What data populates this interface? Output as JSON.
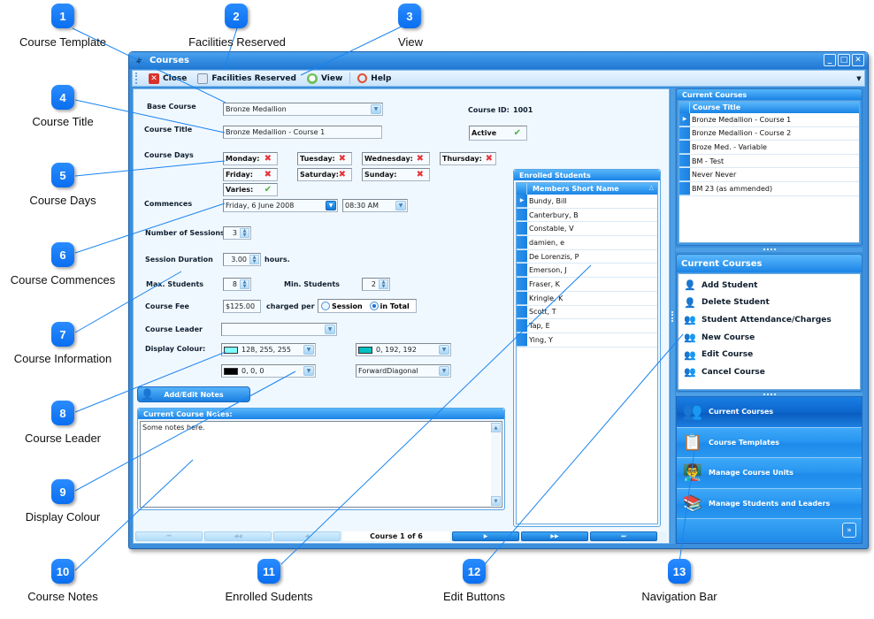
{
  "callouts": [
    {
      "n": "1",
      "label": "Course Template"
    },
    {
      "n": "2",
      "label": "Facilities Reserved"
    },
    {
      "n": "3",
      "label": "View"
    },
    {
      "n": "4",
      "label": "Course Title"
    },
    {
      "n": "5",
      "label": "Course Days"
    },
    {
      "n": "6",
      "label": "Course Commences"
    },
    {
      "n": "7",
      "label": "Course Information"
    },
    {
      "n": "8",
      "label": "Course Leader"
    },
    {
      "n": "9",
      "label": "Display Colour"
    },
    {
      "n": "10",
      "label": "Course Notes"
    },
    {
      "n": "11",
      "label": "Enrolled Sudents"
    },
    {
      "n": "12",
      "label": "Edit Buttons"
    },
    {
      "n": "13",
      "label": "Navigation Bar"
    }
  ],
  "window": {
    "title": "Courses",
    "controls": {
      "minimize": "_",
      "maximize": "□",
      "close": "✕"
    }
  },
  "toolbar": {
    "close": "Close",
    "facilities": "Facilities Reserved",
    "view": "View",
    "help": "Help"
  },
  "form": {
    "base_course_label": "Base Course",
    "base_course_value": "Bronze Medallion",
    "course_title_label": "Course Title",
    "course_title_value": "Bronze Medallion - Course 1",
    "course_id_label": "Course ID:",
    "course_id_value": "1001",
    "active_label": "Active",
    "active_checked": true,
    "course_days_label": "Course Days",
    "days": [
      {
        "label": "Monday:",
        "on": false
      },
      {
        "label": "Tuesday:",
        "on": false
      },
      {
        "label": "Wednesday:",
        "on": false
      },
      {
        "label": "Thursday:",
        "on": false
      },
      {
        "label": "Friday:",
        "on": false
      },
      {
        "label": "Saturday:",
        "on": false
      },
      {
        "label": "Sunday:",
        "on": false
      },
      {
        "label": "Varies:",
        "on": true
      }
    ],
    "commences_label": "Commences",
    "commences_date": "Friday, 6 June 2008",
    "commences_time": "08:30 AM",
    "sessions_label": "Number of Sessions",
    "sessions_value": "3",
    "duration_label": "Session Duration",
    "duration_value": "3.00",
    "duration_unit": "hours.",
    "max_students_label": "Max. Students",
    "max_students_value": "8",
    "min_students_label": "Min. Students",
    "min_students_value": "2",
    "fee_label": "Course Fee",
    "fee_value": "$125.00",
    "charged_per_label": "charged per",
    "charge_options": [
      {
        "label": "Session",
        "selected": false
      },
      {
        "label": "in Total",
        "selected": true
      }
    ],
    "leader_label": "Course Leader",
    "leader_value": "",
    "display_colour_label": "Display Colour:",
    "colour1": {
      "text": "128, 255, 255",
      "hex": "#80ffff"
    },
    "colour2": {
      "text": "0, 192, 192",
      "hex": "#00c0c0"
    },
    "colour3": {
      "text": "0, 0, 0",
      "hex": "#000000"
    },
    "pattern_value": "ForwardDiagonal",
    "add_notes_button": "Add/Edit Notes",
    "notes_header": "Current Course Notes:",
    "notes_text": "Some notes here."
  },
  "enrolled": {
    "header": "Enrolled Students",
    "column": "Members Short Name",
    "sort_indicator": "△",
    "rows": [
      "Bundy, Bill",
      "Canterbury, B",
      "Constable, V",
      "damien, e",
      "De Lorenzis, P",
      "Emerson, J",
      "Fraser, K",
      "Kringle, K",
      "Scott, T",
      "Tap, E",
      "Ying, Y"
    ],
    "selected_index": 0
  },
  "pager": {
    "first": "⏮",
    "prev_page": "◀◀",
    "prev": "◀",
    "status": "Course 1 of 6",
    "next": "▶",
    "next_page": "▶▶",
    "last": "⏭"
  },
  "current_courses": {
    "header": "Current Courses",
    "column": "Course Title",
    "rows": [
      "Bronze Medallion - Course 1",
      "Bronze Medallion - Course 2",
      "Broze Med. - Variable",
      "BM - Test",
      "Never Never",
      "BM 23 (as ammended)"
    ],
    "selected_index": 0
  },
  "actions": {
    "header": "Current Courses",
    "items": [
      "Add Student",
      "Delete Student",
      "Student Attendance/Charges",
      "New Course",
      "Edit Course",
      "Cancel Course"
    ]
  },
  "nav": {
    "items": [
      {
        "label": "Current Courses",
        "active": true
      },
      {
        "label": "Course Templates",
        "active": false
      },
      {
        "label": "Manage Course Units",
        "active": false
      },
      {
        "label": "Manage Students and Leaders",
        "active": false
      }
    ],
    "more": "»"
  }
}
